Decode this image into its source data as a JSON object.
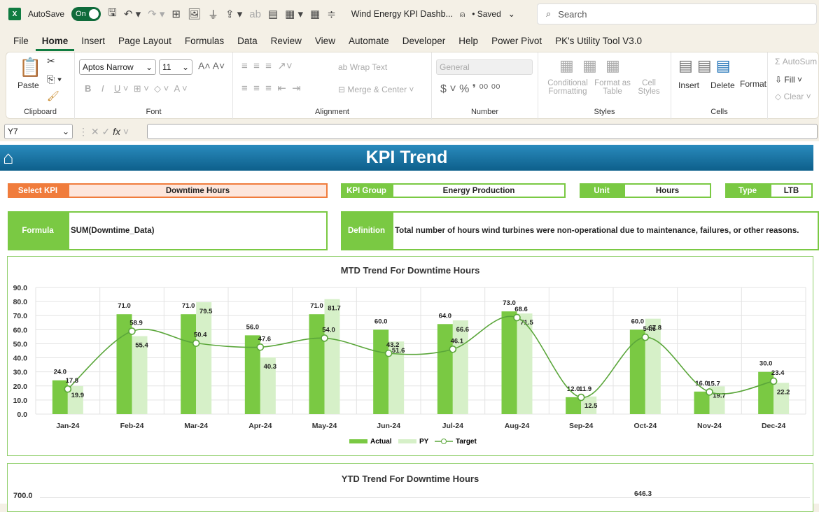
{
  "titlebar": {
    "app_icon": "X",
    "autosave_label": "AutoSave",
    "autosave_state": "On",
    "file_title": "Wind Energy KPI Dashb...",
    "saved": "• Saved",
    "search_placeholder": "Search"
  },
  "menu": [
    "File",
    "Home",
    "Insert",
    "Page Layout",
    "Formulas",
    "Data",
    "Review",
    "View",
    "Automate",
    "Developer",
    "Help",
    "Power Pivot",
    "PK's Utility Tool V3.0"
  ],
  "ribbon": {
    "paste": "Paste",
    "clipboard": "Clipboard",
    "font_name": "Aptos Narrow",
    "font_size": "11",
    "font": "Font",
    "wrap_text": "Wrap Text",
    "merge_center": "Merge & Center",
    "alignment": "Alignment",
    "number_format": "General",
    "number": "Number",
    "conditional_formatting": "Conditional Formatting",
    "format_as_table": "Format as Table",
    "cell_styles": "Cell Styles",
    "styles": "Styles",
    "insert": "Insert",
    "delete": "Delete",
    "format": "Format",
    "cells": "Cells",
    "autosum": "AutoSum",
    "fill": "Fill",
    "clear": "Clear"
  },
  "formula_bar": {
    "name_box": "Y7",
    "formula": ""
  },
  "dashboard": {
    "title": "KPI Trend",
    "select_kpi_label": "Select KPI",
    "select_kpi_value": "Downtime Hours",
    "kpi_group_label": "KPI Group",
    "kpi_group_value": "Energy Production",
    "unit_label": "Unit",
    "unit_value": "Hours",
    "type_label": "Type",
    "type_value": "LTB",
    "formula_label": "Formula",
    "formula_value": "SUM(Downtime_Data)",
    "definition_label": "Definition",
    "definition_value": "Total number of hours wind turbines were non-operational due to maintenance, failures, or other reasons."
  },
  "chart_data": [
    {
      "type": "bar",
      "title": "MTD Trend For Downtime Hours",
      "categories": [
        "Jan-24",
        "Feb-24",
        "Mar-24",
        "Apr-24",
        "May-24",
        "Jun-24",
        "Jul-24",
        "Aug-24",
        "Sep-24",
        "Oct-24",
        "Nov-24",
        "Dec-24"
      ],
      "ylim": [
        0,
        90
      ],
      "yticks": [
        "0.0",
        "10.0",
        "20.0",
        "30.0",
        "40.0",
        "50.0",
        "60.0",
        "70.0",
        "80.0",
        "90.0"
      ],
      "grid": true,
      "legend": "bottom",
      "series": [
        {
          "name": "Actual",
          "type": "bar",
          "color": "#7ac943",
          "values": [
            24.0,
            71.0,
            71.0,
            56.0,
            71.0,
            60.0,
            64.0,
            73.0,
            12.0,
            60.0,
            16.0,
            30.0
          ]
        },
        {
          "name": "PY",
          "type": "bar",
          "color": "#d6f0c8",
          "values": [
            19.9,
            55.4,
            79.5,
            40.3,
            81.7,
            51.6,
            66.6,
            71.5,
            12.5,
            67.8,
            19.7,
            22.2
          ]
        },
        {
          "name": "Target",
          "type": "line",
          "color": "#5aa63a",
          "values": [
            17.8,
            58.9,
            50.4,
            47.6,
            54.0,
            43.2,
            46.1,
            68.6,
            11.9,
            54.6,
            15.7,
            23.4
          ]
        }
      ]
    },
    {
      "type": "bar",
      "title": "YTD Trend For Downtime Hours",
      "ytick_top": "700.0",
      "visible_labels": [
        "646.3"
      ]
    }
  ],
  "colors": {
    "accent": "#7ac943",
    "orange": "#f07c3c",
    "banner": "#1572a3"
  }
}
